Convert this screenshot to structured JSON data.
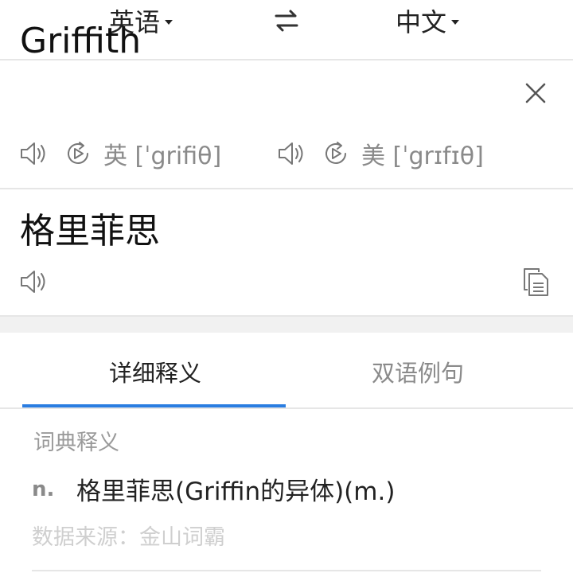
{
  "header": {
    "source_lang": "英语",
    "target_lang": "中文",
    "swap_icon": "swap-arrows-icon"
  },
  "input": {
    "word": "Griffith",
    "phonetics": [
      {
        "label": "英 [ˈgrifiθ]",
        "speaker_icon": "speaker-icon",
        "replay_icon": "replay-icon"
      },
      {
        "label": "美 [ˈgrɪfɪθ]",
        "speaker_icon": "speaker-icon",
        "replay_icon": "replay-icon"
      }
    ],
    "clear_icon": "close-icon"
  },
  "result": {
    "translation": "格里菲思",
    "speaker_icon": "speaker-icon",
    "copy_icon": "copy-icon"
  },
  "tabs": [
    {
      "label": "详细释义",
      "active": true
    },
    {
      "label": "双语例句",
      "active": false
    }
  ],
  "dictionary": {
    "section_title": "词典释义",
    "entries": [
      {
        "pos": "n.",
        "meaning": "格里菲思(Griffin的异体)(m.)"
      }
    ],
    "source": "数据来源：金山词霸"
  },
  "colors": {
    "accent": "#2a7de1",
    "divider": "#e6e6e6",
    "muted_text": "#8a8a8a",
    "faint_text": "#cfcfcf",
    "gap_bg": "#f1f1f1"
  }
}
